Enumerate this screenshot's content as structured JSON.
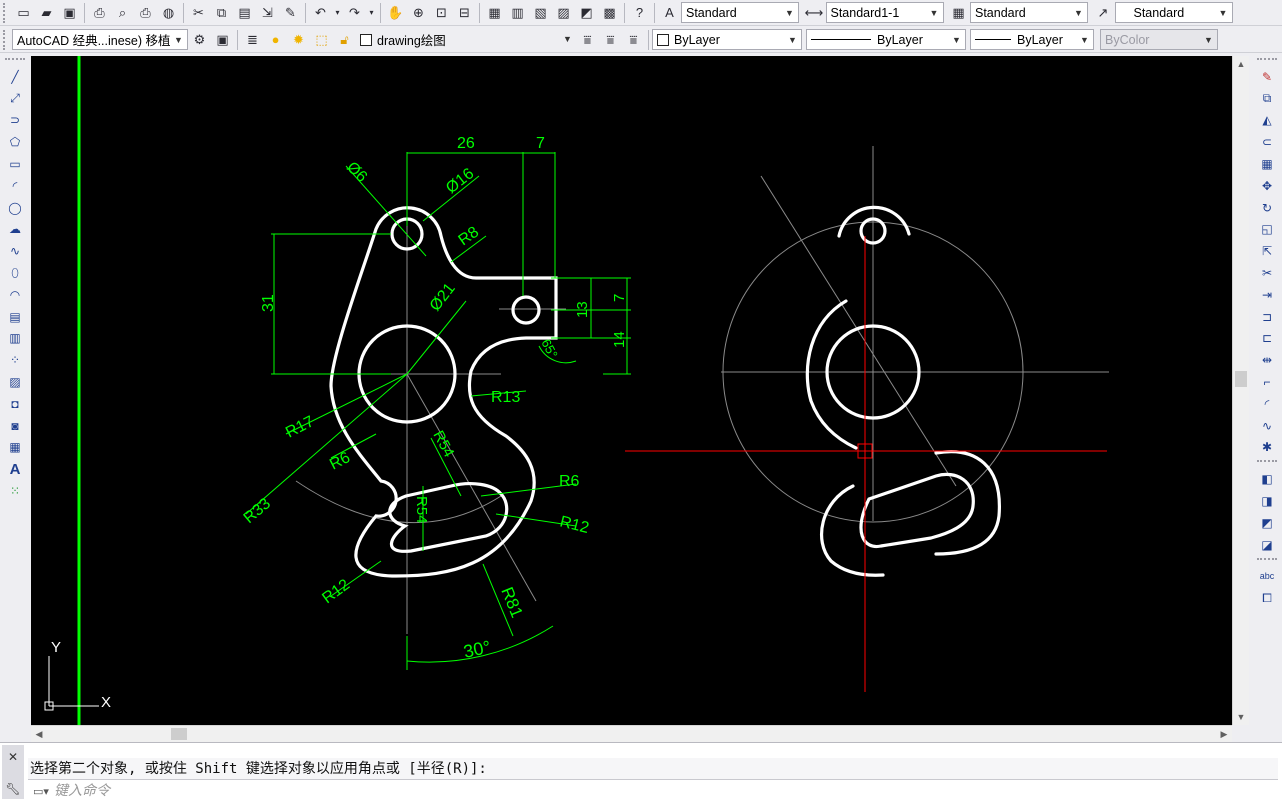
{
  "toolbar1": {
    "text_style": "Standard",
    "dim_style": "Standard1-1",
    "table_style": "Standard",
    "mleader_style": "Standard"
  },
  "toolbar2": {
    "workspace": "AutoCAD 经典...inese) 移植",
    "layer": "drawing绘图",
    "color": "ByLayer",
    "linetype": "ByLayer",
    "lineweight": "ByLayer",
    "plotstyle": "ByColor"
  },
  "drawing": {
    "dim_26": "26",
    "dim_7_top": "7",
    "dim_31": "31",
    "dim_13": "13",
    "dim_7_right": "7",
    "dim_14": "14",
    "phi6": "Ø6",
    "phi16": "Ø16",
    "phi21": "Ø21",
    "r8": "R8",
    "r13": "R13",
    "r17": "R17",
    "r6_left": "R6",
    "r33": "R33",
    "r54_a": "R54",
    "r54_b": "R54",
    "r6_right": "R6",
    "r12_right": "R12",
    "r12_bottom": "R12",
    "r81": "R81",
    "angle30": "30°",
    "angle65": "65°",
    "ucs_x": "X",
    "ucs_y": "Y",
    "colors": {
      "background": "#000000",
      "geometry": "#ffffff",
      "dimension": "#00ff00",
      "centerline": "#8a8a8a",
      "crosshair": "#ff0000"
    }
  },
  "command": {
    "history": "选择第二个对象, 或按住 Shift 键选择对象以应用角点或 [半径(R)]:",
    "placeholder": "键入命令"
  }
}
